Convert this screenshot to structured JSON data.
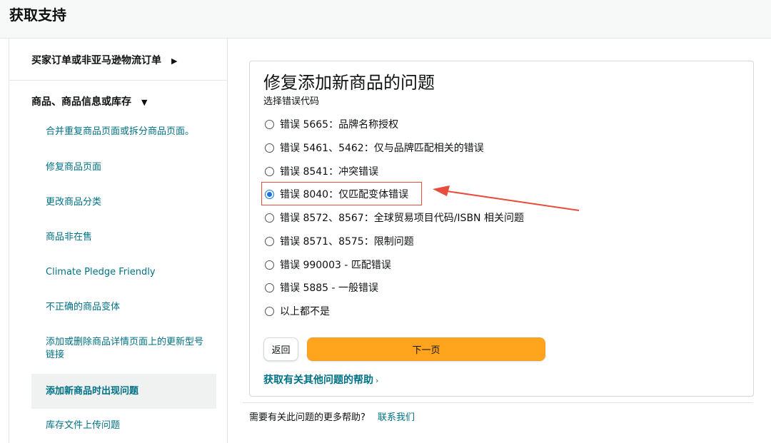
{
  "header": {
    "title": "获取支持"
  },
  "sidebar": {
    "categories": [
      {
        "label": "买家订单或非亚马逊物流订单",
        "caret": "▶"
      },
      {
        "label": "商品、商品信息或库存",
        "caret": "▼"
      }
    ],
    "sub_items": [
      "合并重复商品页面或拆分商品页面。",
      "修复商品页面",
      "更改商品分类",
      "商品非在售",
      "Climate Pledge Friendly",
      "不正确的商品变体",
      "添加或删除商品详情页面上的更新型号链接",
      "添加新商品时出现问题",
      "库存文件上传问题"
    ],
    "active_item": "添加新商品时出现问题"
  },
  "main": {
    "heading": "修复添加新商品的问题",
    "subheading": "选择错误代码",
    "options": [
      "错误 5665：品牌名称授权",
      "错误 5461、5462：仅与品牌匹配相关的错误",
      "错误 8541：冲突错误",
      "错误 8040：仅匹配变体错误",
      "错误 8572、8567：全球贸易项目代码/ISBN 相关问题",
      "错误 8571、8575：限制问题",
      "错误 990003 - 匹配错误",
      "错误 5885 - 一般错误",
      "以上都不是"
    ],
    "selected_option": "错误 8040：仅匹配变体错误",
    "back_label": "返回",
    "next_label": "下一页",
    "help_link": "获取有关其他问题的帮助",
    "help_chevron": "›"
  },
  "footer": {
    "text": "需要有关此问题的更多帮助?",
    "link": "联系我们"
  },
  "colors": {
    "link": "#007185",
    "primary_button": "#ffa41c",
    "annotation": "#e74c3c",
    "radio_selected": "#1a73e8"
  },
  "icons": [
    "caret-right-icon",
    "caret-down-icon",
    "radio-icon",
    "chevron-right-icon",
    "annotation-arrow-icon"
  ]
}
